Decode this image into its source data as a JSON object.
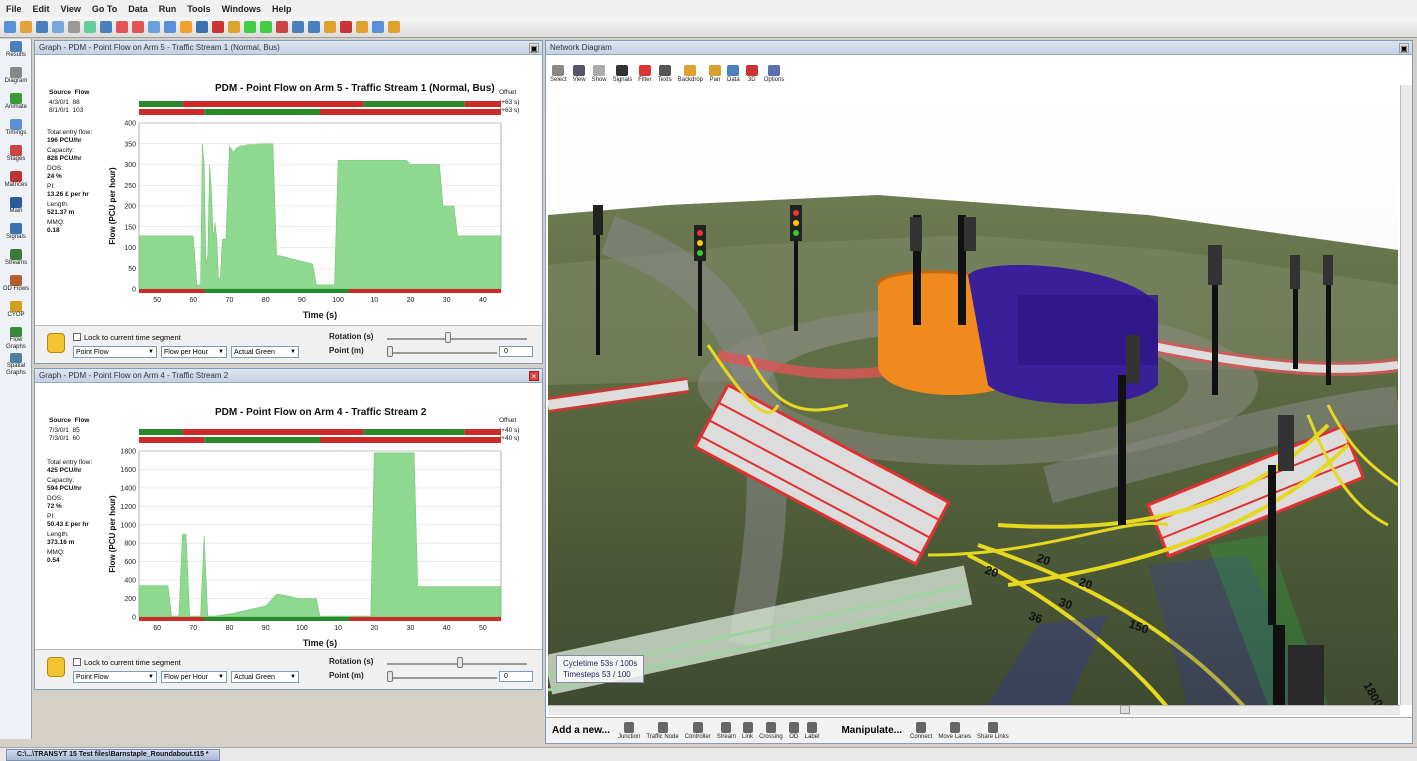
{
  "menu": [
    "File",
    "Edit",
    "View",
    "Go To",
    "Data",
    "Run",
    "Tools",
    "Windows",
    "Help"
  ],
  "sidebar": [
    "Results",
    "Diagram",
    "Animate",
    "Timings",
    "Stages",
    "Matrices",
    "Main",
    "Signals",
    "Streams",
    "OD Flows",
    "CYOP",
    "Flow Graphs",
    "Spatial Graphs"
  ],
  "graph1": {
    "window_title": "Graph - PDM - Point Flow on Arm 5 - Traffic Stream 1 (Normal, Bus)",
    "title": "PDM - Point Flow on Arm 5 - Traffic Stream 1 (Normal, Bus)",
    "source_hdr": "Source",
    "flow_hdr": "Flow",
    "offset_hdr": "Offset",
    "sources": [
      {
        "s": "4/3/0/1",
        "f": "88"
      },
      {
        "s": "8/1/0/1",
        "f": "103"
      }
    ],
    "offsets": [
      "(+63 s)",
      "(+63 s)"
    ],
    "stats": [
      [
        "Total entry flow:",
        "196 PCU/hr"
      ],
      [
        "Capacity:",
        "828 PCU/hr"
      ],
      [
        "DOS:",
        "24 %"
      ],
      [
        "PI:",
        "13.26 £ per hr"
      ],
      [
        "Length:",
        "521.37 m"
      ],
      [
        "MMQ:",
        "0.18"
      ]
    ],
    "ylabel": "Flow (PCU per hour)",
    "xlabel": "Time (s)",
    "lock_label": "Lock to current time segment",
    "select1": "Point Flow",
    "select2": "Flow per Hour",
    "select3": "Actual Green",
    "rotation_label": "Rotation (s)",
    "point_label": "Point (m)",
    "point_value": "0"
  },
  "graph2": {
    "window_title": "Graph - PDM - Point Flow on Arm 4 - Traffic Stream 2",
    "title": "PDM - Point Flow on Arm 4 - Traffic Stream 2",
    "source_hdr": "Source",
    "flow_hdr": "Flow",
    "offset_hdr": "Offset",
    "sources": [
      {
        "s": "7/3/0/1",
        "f": "85"
      },
      {
        "s": "7/3/0/1",
        "f": "60"
      }
    ],
    "offsets": [
      "(+40 s)",
      "(+40 s)"
    ],
    "stats": [
      [
        "Total entry flow:",
        "425 PCU/hr"
      ],
      [
        "Capacity:",
        "594 PCU/hr"
      ],
      [
        "DOS:",
        "72 %"
      ],
      [
        "PI:",
        "50.43 £ per hr"
      ],
      [
        "Length:",
        "373.16 m"
      ],
      [
        "MMQ:",
        "0.54"
      ]
    ],
    "ylabel": "Flow (PCU per hour)",
    "xlabel": "Time (s)",
    "lock_label": "Lock to current time segment",
    "select1": "Point Flow",
    "select2": "Flow per Hour",
    "select3": "Actual Green",
    "rotation_label": "Rotation (s)",
    "point_label": "Point (m)",
    "point_value": "0"
  },
  "network": {
    "title": "Network Diagram",
    "toolbar": [
      "Select",
      "View",
      "Show",
      "Signals",
      "Filter",
      "Texts",
      "Backdrop",
      "Pan",
      "Data",
      "3D",
      "Options"
    ],
    "cycletime": "Cycletime 53s / 100s",
    "timesteps": "Timesteps 53 / 100",
    "add_label": "Add a new...",
    "add_items": [
      "Junction",
      "Traffic Node",
      "Controller",
      "Stream",
      "Link",
      "Crossing",
      "OD",
      "Label"
    ],
    "manip_label": "Manipulate...",
    "manip_items": [
      "Connect",
      "Move Lanes",
      "Share Links"
    ],
    "road_labels": [
      "20",
      "20",
      "20",
      "30",
      "36",
      "150",
      "1800"
    ]
  },
  "statusbar": {
    "file_tab": "C:\\...\\TRANSYT 15 Test files\\Barnstaple_Roundabout.t15 *"
  },
  "chart_data": [
    {
      "type": "area",
      "title": "PDM - Point Flow on Arm 5 - Traffic Stream 1 (Normal, Bus)",
      "xlabel": "Time (s)",
      "ylabel": "Flow (PCU per hour)",
      "ylim": [
        0,
        400
      ],
      "yticks": [
        0,
        50,
        100,
        150,
        200,
        250,
        300,
        350,
        400
      ],
      "xtick_labels": [
        "50",
        "60",
        "70",
        "80",
        "90",
        "100",
        "10",
        "20",
        "30",
        "40"
      ],
      "xlim": [
        45,
        145
      ],
      "x": [
        45,
        60,
        61,
        62,
        62.5,
        63,
        63.5,
        64,
        64.5,
        65,
        65.5,
        66,
        66.5,
        67,
        67.5,
        68,
        69,
        70,
        71,
        72,
        73,
        74,
        75,
        76,
        77,
        78,
        79,
        80,
        81,
        82,
        83,
        84,
        93,
        94,
        99,
        100,
        119,
        120,
        128,
        129,
        132,
        133,
        145
      ],
      "values": [
        128,
        128,
        10,
        10,
        350,
        300,
        60,
        80,
        300,
        240,
        120,
        160,
        120,
        20,
        30,
        120,
        120,
        345,
        330,
        340,
        345,
        345,
        348,
        348,
        348,
        350,
        350,
        350,
        350,
        350,
        80,
        80,
        60,
        10,
        10,
        310,
        310,
        300,
        300,
        200,
        200,
        128,
        128
      ]
    },
    {
      "type": "area",
      "title": "PDM - Point Flow on Arm 4 - Traffic Stream 2",
      "xlabel": "Time (s)",
      "ylabel": "Flow (PCU per hour)",
      "ylim": [
        0,
        1800
      ],
      "yticks": [
        0,
        200,
        400,
        600,
        800,
        1000,
        1200,
        1400,
        1600,
        1800
      ],
      "xtick_labels": [
        "60",
        "70",
        "80",
        "90",
        "100",
        "10",
        "20",
        "30",
        "40",
        "50"
      ],
      "xlim": [
        52,
        152
      ],
      "x": [
        52,
        60,
        61,
        63,
        64,
        65,
        66,
        67,
        69,
        70,
        71,
        73,
        78,
        87,
        90,
        93,
        96,
        101,
        102,
        116,
        117,
        128,
        129,
        152
      ],
      "values": [
        340,
        340,
        10,
        10,
        900,
        900,
        10,
        10,
        10,
        880,
        10,
        10,
        40,
        120,
        250,
        230,
        200,
        200,
        10,
        10,
        1780,
        1780,
        330,
        330
      ]
    }
  ]
}
